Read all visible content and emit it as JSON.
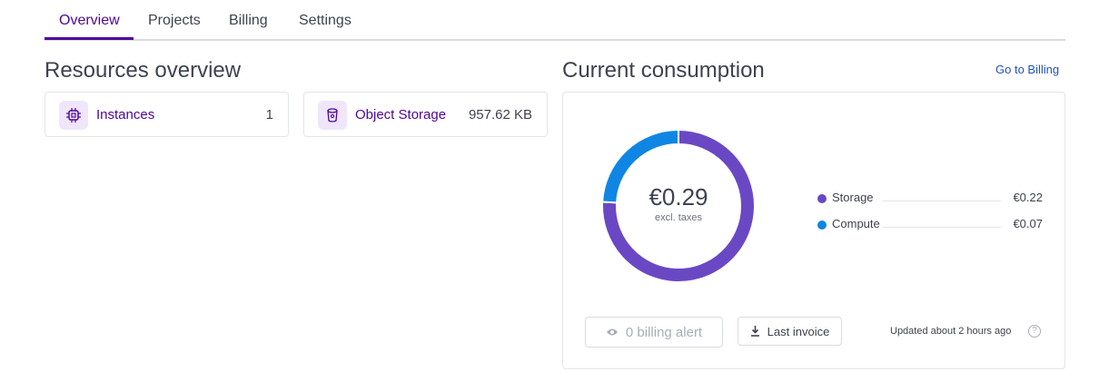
{
  "tabs": [
    {
      "label": "Overview",
      "active": true
    },
    {
      "label": "Projects",
      "active": false
    },
    {
      "label": "Billing",
      "active": false
    },
    {
      "label": "Settings",
      "active": false
    }
  ],
  "resources": {
    "title": "Resources overview",
    "cards": [
      {
        "label": "Instances",
        "value": "1",
        "icon": "cpu-chip-icon"
      },
      {
        "label": "Object Storage",
        "value": "957.62 KB",
        "icon": "storage-bucket-icon"
      }
    ]
  },
  "consumption": {
    "title": "Current consumption",
    "link_label": "Go to Billing",
    "total": "€0.29",
    "total_note": "excl. taxes",
    "breakdown": [
      {
        "name": "Storage",
        "value": "€0.22",
        "amount": 0.22,
        "color": "#6a48c4"
      },
      {
        "name": "Compute",
        "value": "€0.07",
        "amount": 0.07,
        "color": "#0f86e3"
      }
    ],
    "alert_button": "0 billing alert",
    "invoice_button": "Last invoice",
    "updated_text": "Updated about 2 hours ago",
    "help_glyph": "?"
  },
  "colors": {
    "accent": "#4f0599",
    "link": "#2150c4",
    "storage": "#6a48c4",
    "compute": "#0f86e3"
  }
}
